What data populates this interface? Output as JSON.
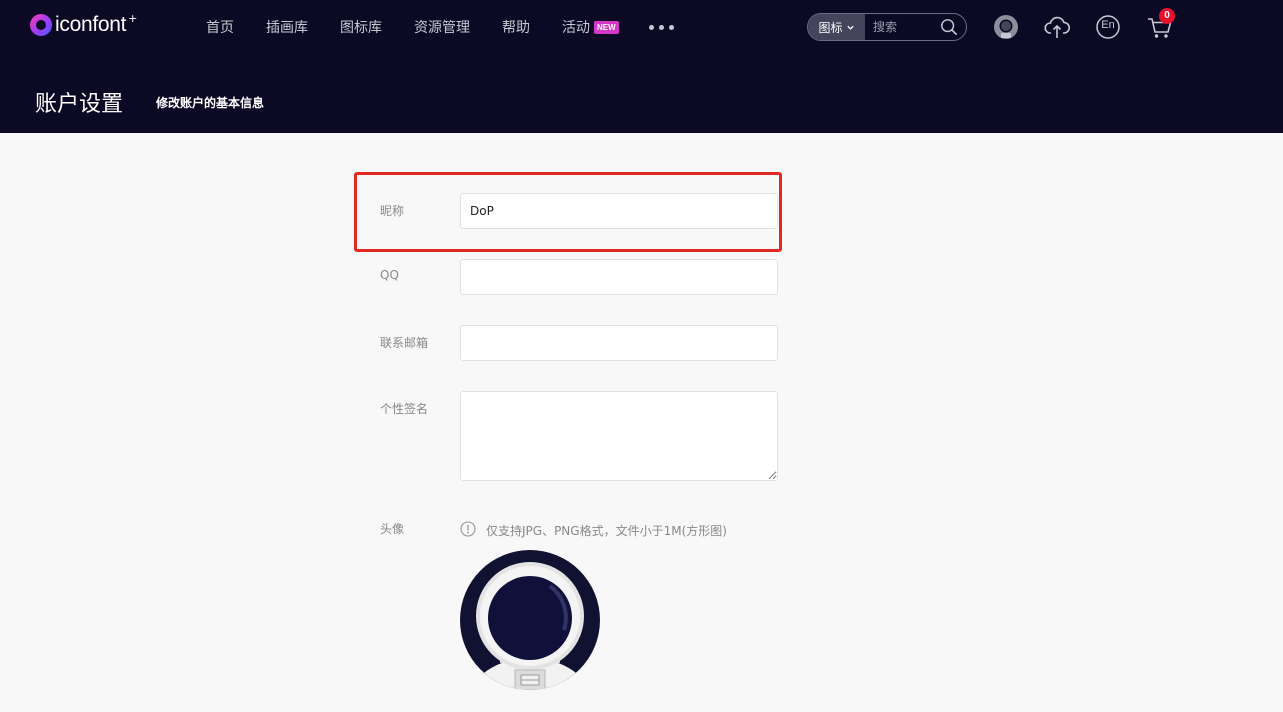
{
  "header": {
    "logo_text": "iconfont",
    "logo_plus": "+",
    "nav": [
      {
        "label": "首页"
      },
      {
        "label": "插画库"
      },
      {
        "label": "图标库"
      },
      {
        "label": "资源管理"
      },
      {
        "label": "帮助"
      },
      {
        "label": "活动",
        "badge": "NEW"
      }
    ],
    "more_icon": "more-dots-icon",
    "search": {
      "type_label": "图标",
      "placeholder": "搜索"
    },
    "icons": [
      "user-avatar-icon",
      "upload-icon",
      "language-en-icon",
      "cart-icon"
    ],
    "language_label": "En",
    "cart_count": "0",
    "page_title": "账户设置",
    "page_subtitle": "修改账户的基本信息"
  },
  "form": {
    "nickname": {
      "label": "昵称",
      "value": "DoP"
    },
    "qq": {
      "label": "QQ",
      "value": ""
    },
    "email": {
      "label": "联系邮箱",
      "value": ""
    },
    "signature": {
      "label": "个性签名",
      "value": ""
    },
    "avatar": {
      "label": "头像",
      "tip": "仅支持JPG、PNG格式，文件小于1M(方形图)",
      "tip_icon": "info-icon",
      "image": "astronaut-avatar"
    }
  },
  "colors": {
    "header_bg": "#0c0925",
    "page_bg": "#f8f8f8",
    "highlight": "#e02a21",
    "badge_new": "#d436c5",
    "cart_badge": "#e8112d"
  }
}
